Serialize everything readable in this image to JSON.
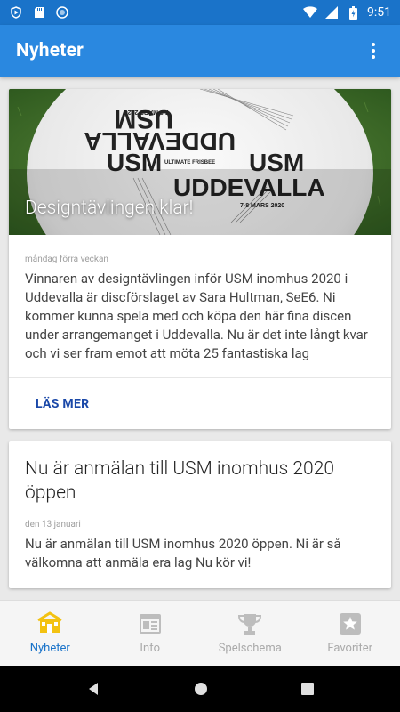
{
  "status_bar": {
    "time": "9:51",
    "icons": [
      "play-protect-icon",
      "sd-card-icon",
      "sync-icon",
      "wifi-icon",
      "signal-icon",
      "battery-charging-icon"
    ]
  },
  "app_bar": {
    "title": "Nyheter",
    "menu_icon": "more-vert-icon"
  },
  "news": [
    {
      "image_title": "Designtävlingen klar!",
      "date": "måndag förra veckan",
      "text": "Vinnaren av designtävlingen inför USM inomhus 2020 i Uddevalla är discförslaget av Sara Hultman, SeE6. Ni kommer kunna spela med och köpa den här fina discen under arrangemanget i Uddevalla. Nu är det inte långt kvar och vi ser fram emot att möta 25 fantastiska lag",
      "action": "LÄS MER",
      "disc": {
        "top_left": "USM",
        "top_right": "UDDEVALLA",
        "top_dates": "7-8 MARS 2020",
        "brand": "ULTIMATE FRISBEE",
        "bottom_left": "USM",
        "bottom_right": "UDDEVALLA",
        "bottom_dates": "7-8 MARS 2020"
      }
    },
    {
      "title": "Nu är anmälan till USM inomhus 2020 öppen",
      "date": "den 13 januari",
      "text": "Nu är anmälan till USM inomhus 2020 öppen. Ni är så välkomna att anmäla era lag    Nu kör vi!"
    }
  ],
  "bottom_nav": [
    {
      "label": "Nyheter",
      "icon": "home-icon",
      "active": true
    },
    {
      "label": "Info",
      "icon": "info-panel-icon",
      "active": false
    },
    {
      "label": "Spelschema",
      "icon": "trophy-icon",
      "active": false
    },
    {
      "label": "Favoriter",
      "icon": "star-icon",
      "active": false
    }
  ],
  "colors": {
    "status_bar": "#1a73c9",
    "app_bar": "#2a88e0",
    "accent_active": "#f3c211",
    "link": "#1a48a8"
  }
}
